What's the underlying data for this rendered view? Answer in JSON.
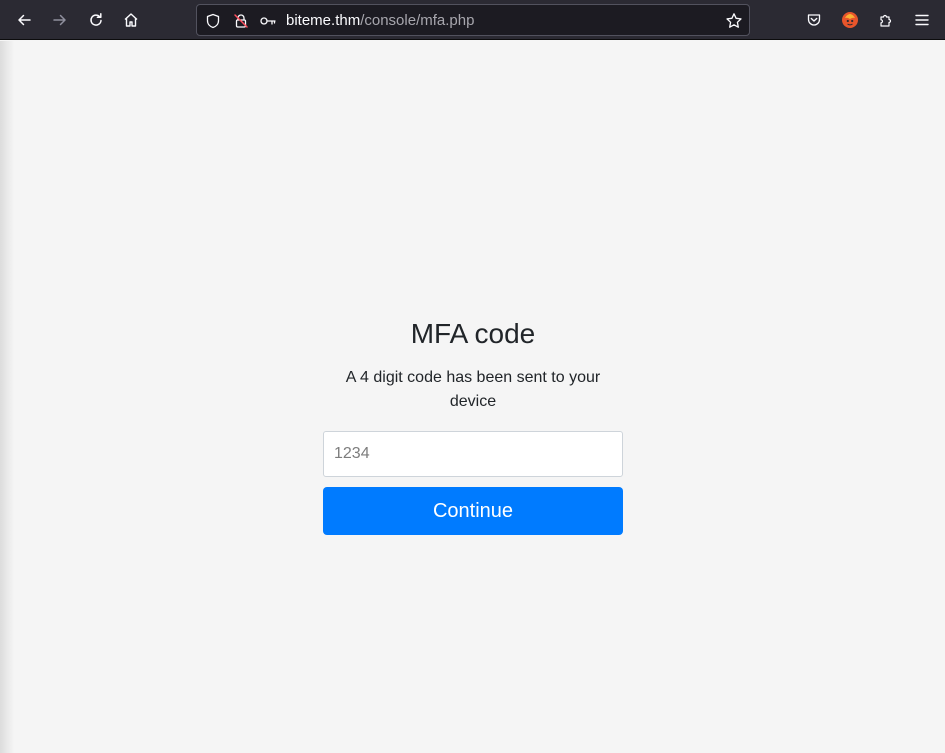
{
  "browser": {
    "url_host": "biteme.thm",
    "url_path": "/console/mfa.php",
    "icons": [
      "back-icon",
      "forward-icon",
      "reload-icon",
      "home-icon",
      "shield-icon",
      "insecure-lock-icon",
      "key-icon",
      "bookmark-star-icon",
      "pocket-icon",
      "extension-avatar-icon",
      "extensions-icon",
      "menu-icon"
    ]
  },
  "form": {
    "title": "MFA code",
    "subtitle": "A 4 digit code has been sent to your device",
    "input_placeholder": "1234",
    "input_value": "",
    "button_label": "Continue"
  },
  "colors": {
    "toolbar": "#2b2a33",
    "page_background": "#f5f5f5",
    "button": "#007bff"
  }
}
